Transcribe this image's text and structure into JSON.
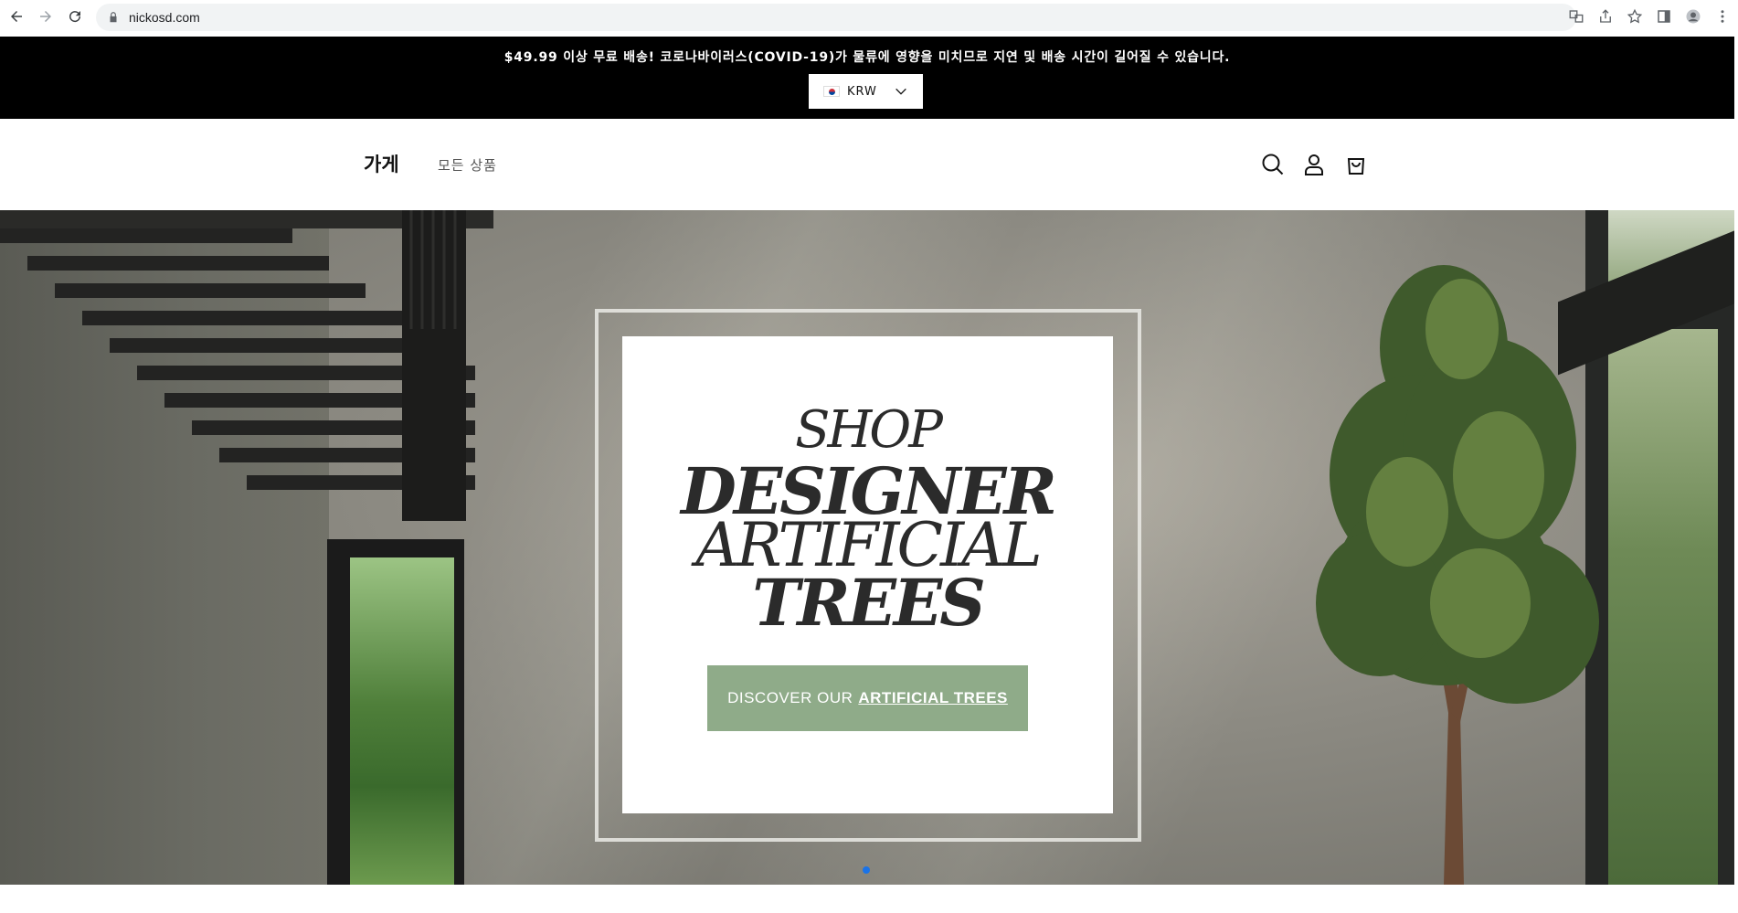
{
  "browser": {
    "url": "nickosd.com"
  },
  "announcement": {
    "text": "$49.99 이상 무료 배송! 코로나바이러스(COVID-19)가 물류에 영향을 미치므로 지연 및 배송 시간이 길어질 수 있습니다.",
    "currency_code": "KRW",
    "flag_icon": "korea-flag-icon"
  },
  "header": {
    "logo": "가게",
    "nav_link": "모든 상품",
    "icons": [
      "search-icon",
      "account-icon",
      "cart-icon"
    ]
  },
  "hero": {
    "line1": "SHOP",
    "line2": "DESIGNER",
    "line3": "ARTIFICIAL",
    "line4": "TREES",
    "cta_prefix": "DISCOVER OUR",
    "cta_emphasis": "ARTIFICIAL TREES",
    "cta_color": "#8fab89",
    "active_slide_color": "#1a73e8"
  }
}
